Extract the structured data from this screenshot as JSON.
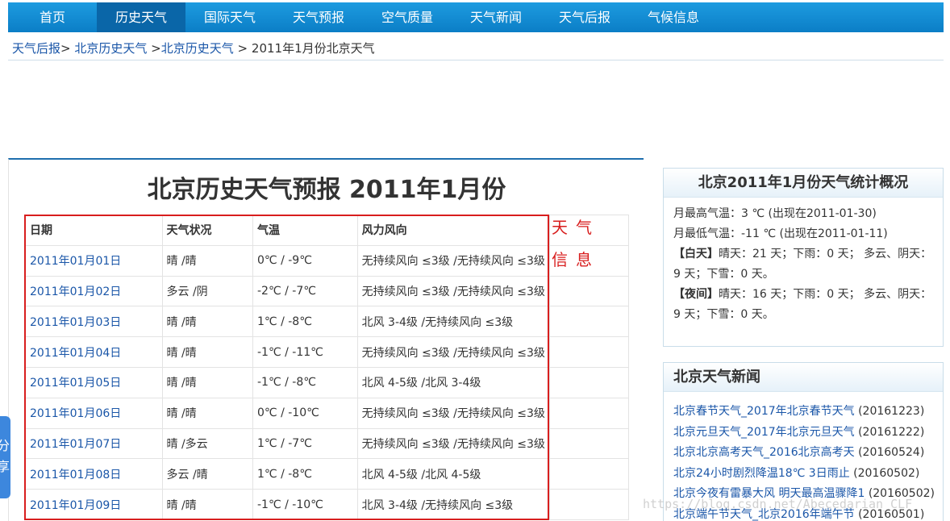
{
  "nav": {
    "items": [
      {
        "label": "首页",
        "active": false
      },
      {
        "label": "历史天气",
        "active": true
      },
      {
        "label": "国际天气",
        "active": false
      },
      {
        "label": "天气预报",
        "active": false
      },
      {
        "label": "空气质量",
        "active": false
      },
      {
        "label": "天气新闻",
        "active": false
      },
      {
        "label": "天气后报",
        "active": false
      },
      {
        "label": "气候信息",
        "active": false
      }
    ]
  },
  "breadcrumb": {
    "link1": "天气后报",
    "sep1": ">",
    "link2": "北京历史天气",
    "sep2": ">",
    "link3": "北京历史天气",
    "sep3": ">",
    "current": "2011年1月份北京天气"
  },
  "main": {
    "title": "北京历史天气预报 2011年1月份",
    "annotation_line1": "天气",
    "annotation_line2": "信息",
    "table": {
      "headers": [
        "日期",
        "天气状况",
        "气温",
        "风力风向"
      ],
      "rows": [
        [
          "2011年01月01日",
          "晴 /晴",
          "0℃ / -9℃",
          "无持续风向 ≤3级 /无持续风向 ≤3级"
        ],
        [
          "2011年01月02日",
          "多云 /阴",
          "-2℃ / -7℃",
          "无持续风向 ≤3级 /无持续风向 ≤3级"
        ],
        [
          "2011年01月03日",
          "晴 /晴",
          "1℃ / -8℃",
          "北风 3-4级 /无持续风向 ≤3级"
        ],
        [
          "2011年01月04日",
          "晴 /晴",
          "-1℃ / -11℃",
          "无持续风向 ≤3级 /无持续风向 ≤3级"
        ],
        [
          "2011年01月05日",
          "晴 /晴",
          "-1℃ / -8℃",
          "北风 4-5级 /北风 3-4级"
        ],
        [
          "2011年01月06日",
          "晴 /晴",
          "0℃ / -10℃",
          "无持续风向 ≤3级 /无持续风向 ≤3级"
        ],
        [
          "2011年01月07日",
          "晴 /多云",
          "1℃ / -7℃",
          "无持续风向 ≤3级 /无持续风向 ≤3级"
        ],
        [
          "2011年01月08日",
          "多云 /晴",
          "1℃ / -8℃",
          "北风 4-5级 /北风 4-5级"
        ],
        [
          "2011年01月09日",
          "晴 /晴",
          "-1℃ / -10℃",
          "北风 3-4级 /无持续风向 ≤3级"
        ]
      ]
    }
  },
  "stats": {
    "title": "北京2011年1月份天气统计概况",
    "max_temp": "月最高气温：3 ℃ (出现在2011-01-30)",
    "min_temp": "月最低气温：-11 ℃ (出现在2011-01-11)",
    "day_label": "【白天】",
    "day_text": "晴天：21 天；下雨：0 天； 多云、阴天：9 天；下雪：0 天。",
    "night_label": "【夜间】",
    "night_text": "晴天：16 天；下雨：0 天； 多云、阴天：9 天；下雪：0 天。"
  },
  "news": {
    "title": "北京天气新闻",
    "items": [
      {
        "title": "北京春节天气_2017年北京春节天气",
        "date": "(20161223)"
      },
      {
        "title": "北京元旦天气_2017年北京元旦天气",
        "date": "(20161222)"
      },
      {
        "title": "北京北京高考天气_2016北京高考天",
        "date": "(20160524)"
      },
      {
        "title": "北京24小时剧烈降温18℃ 3日雨止",
        "date": "(20160502)"
      },
      {
        "title": "北京今夜有雷暴大风 明天最高温骤降1",
        "date": "(20160502)"
      },
      {
        "title": "北京端午节天气_北京2016年端午节",
        "date": "(20160501)"
      }
    ]
  },
  "share": {
    "label1": "分",
    "label2": "享"
  },
  "watermark": "https://blog.csdn.net/Abecedarian_CLF"
}
